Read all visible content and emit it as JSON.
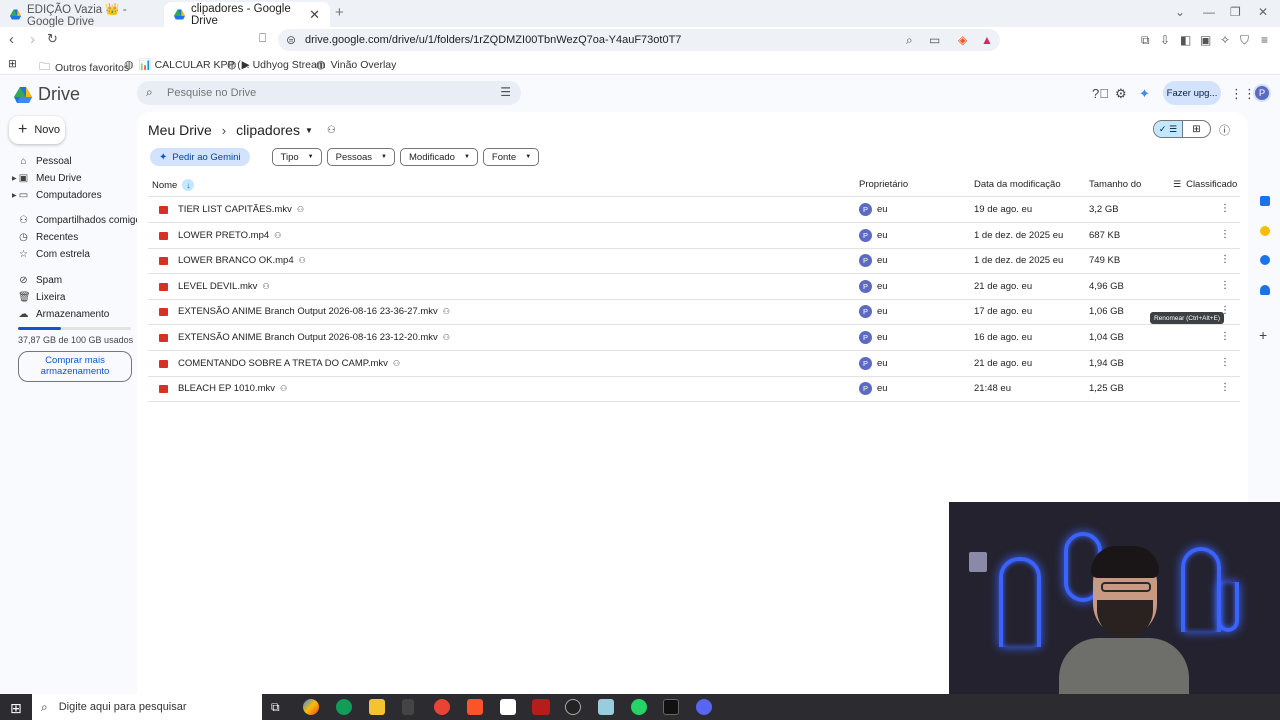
{
  "browser": {
    "tabs": [
      {
        "title": "EDIÇÃO Vazia 👑 - Google Drive"
      },
      {
        "title": "clipadores - Google Drive"
      }
    ],
    "url": "drive.google.com/drive/u/1/folders/1rZQDMZI00TbnWezQ7oa-Y4auF73ot0T7",
    "bookmarks": [
      {
        "label": "Outros favoritos",
        "icon": "folder-icon"
      },
      {
        "label": "📊 CALCULAR KPP (...",
        "icon": "globe-icon"
      },
      {
        "label": "▶ Udhyog Stream",
        "icon": "globe-icon"
      },
      {
        "label": "Vinão Overlay",
        "icon": "globe-icon"
      }
    ]
  },
  "drive": {
    "app_name": "Drive",
    "search_placeholder": "Pesquise no Drive",
    "upgrade_label": "Fazer upg...",
    "avatar_letter": "P",
    "new_label": "Novo",
    "sidebar": [
      {
        "label": "Pessoal",
        "icon": "home-icon"
      },
      {
        "label": "Meu Drive",
        "icon": "drive-icon"
      },
      {
        "label": "Computadores",
        "icon": "computer-icon"
      },
      {
        "label": "Compartilhados comigo",
        "icon": "people-icon"
      },
      {
        "label": "Recentes",
        "icon": "clock-icon"
      },
      {
        "label": "Com estrela",
        "icon": "star-icon"
      },
      {
        "label": "Spam",
        "icon": "spam-icon"
      },
      {
        "label": "Lixeira",
        "icon": "trash-icon"
      },
      {
        "label": "Armazenamento",
        "icon": "cloud-icon"
      }
    ],
    "storage": {
      "used_text": "37,87 GB de 100 GB usados",
      "used_fraction": 0.3787,
      "buy_label": "Comprar mais armazenamento"
    },
    "breadcrumb": {
      "root": "Meu Drive",
      "current": "clipadores"
    },
    "filters": {
      "gemini": "Pedir ao Gemini",
      "chips": [
        "Tipo",
        "Pessoas",
        "Modificado",
        "Fonte"
      ]
    },
    "columns": {
      "name": "Nome",
      "owner": "Proprietário",
      "modified": "Data da modificação",
      "size": "Tamanho do",
      "sort": "Classificado"
    },
    "files": [
      {
        "name": "TIER LIST CAPITÃES.mkv",
        "owner": "eu",
        "modified": "19 de ago. eu",
        "size": "3,2 GB"
      },
      {
        "name": "LOWER PRETO.mp4",
        "owner": "eu",
        "modified": "1 de dez. de 2025 eu",
        "size": "687 KB"
      },
      {
        "name": "LOWER BRANCO OK.mp4",
        "owner": "eu",
        "modified": "1 de dez. de 2025 eu",
        "size": "749 KB"
      },
      {
        "name": "LEVEL DEVIL.mkv",
        "owner": "eu",
        "modified": "21 de ago. eu",
        "size": "4,96 GB"
      },
      {
        "name": "EXTENSÃO ANIME Branch Output 2026-08-16 23-36-27.mkv",
        "owner": "eu",
        "modified": "17 de ago. eu",
        "size": "1,06 GB"
      },
      {
        "name": "EXTENSÃO ANIME Branch Output 2026-08-16 23-12-20.mkv",
        "owner": "eu",
        "modified": "16 de ago. eu",
        "size": "1,04 GB"
      },
      {
        "name": "COMENTANDO SOBRE A TRETA DO CAMP.mkv",
        "owner": "eu",
        "modified": "21 de ago. eu",
        "size": "1,94 GB"
      },
      {
        "name": "BLEACH EP 1010.mkv",
        "owner": "eu",
        "modified": "21:48 eu",
        "size": "1,25 GB"
      }
    ],
    "owner_avatar_letter": "P",
    "tooltip": "Renomear (Ctrl+Alt+E)"
  },
  "taskbar": {
    "search_placeholder": "Digite aqui para pesquisar"
  },
  "colors": {
    "accent": "#0b57d0",
    "file_icon": "#d93025",
    "chip_bg": "#d3e3fd"
  }
}
